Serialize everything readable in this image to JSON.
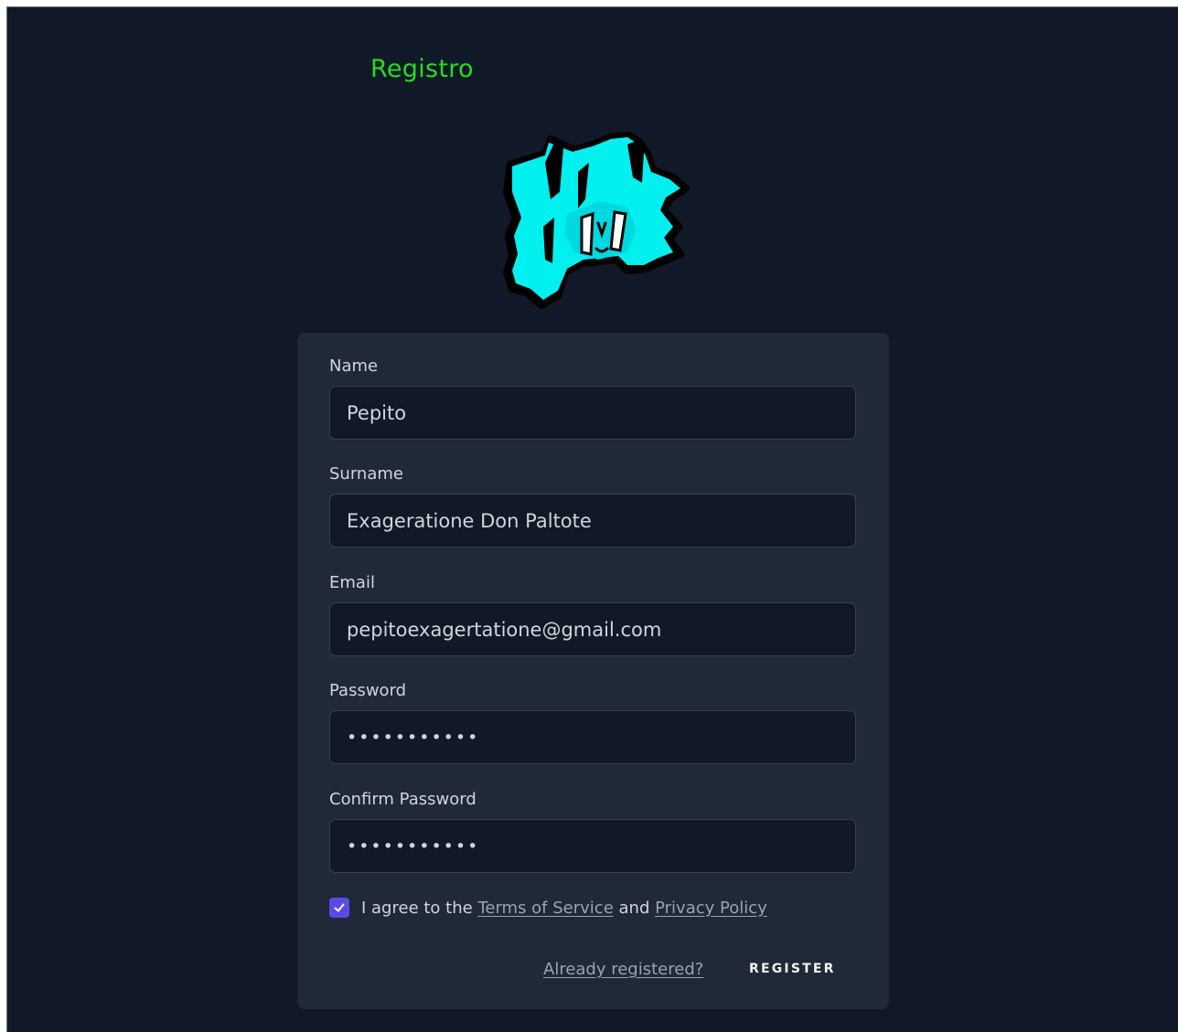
{
  "page": {
    "title": "Registro"
  },
  "form": {
    "name": {
      "label": "Name",
      "value": "Pepito"
    },
    "surname": {
      "label": "Surname",
      "value": "Exageratione Don Paltote"
    },
    "email": {
      "label": "Email",
      "value": "pepitoexagertatione@gmail.com"
    },
    "password": {
      "label": "Password",
      "value": "•••••••••••"
    },
    "confirm_password": {
      "label": "Confirm Password",
      "value": "•••••••••••"
    },
    "agree": {
      "checked": true,
      "text_before": "I agree to the",
      "terms_link": "Terms of Service",
      "text_and": "and",
      "privacy_link": "Privacy Policy"
    },
    "already_registered": "Already registered?",
    "register_button": "REGISTER"
  },
  "colors": {
    "background": "#111827",
    "card": "#1f2937",
    "title": "#22dd22",
    "checkbox": "#5b4be6",
    "logo_fill": "#00f0f0"
  },
  "icons": {
    "logo": "cyan-mascot-logo",
    "checkbox": "checkmark-icon"
  }
}
